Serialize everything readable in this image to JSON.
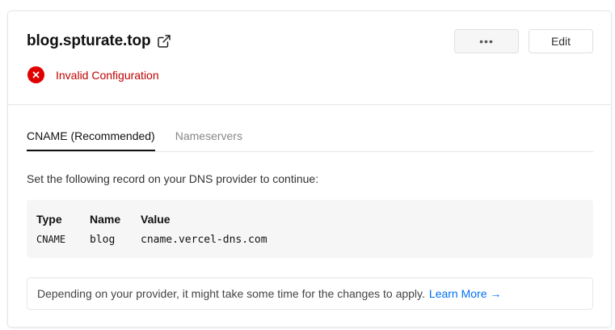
{
  "domain": {
    "name": "blog.spturate.top",
    "status": "Invalid Configuration"
  },
  "actions": {
    "more_label": "•••",
    "edit_label": "Edit"
  },
  "tabs": [
    {
      "label": "CNAME (Recommended)",
      "active": true
    },
    {
      "label": "Nameservers",
      "active": false
    }
  ],
  "instructions": "Set the following record on your DNS provider to continue:",
  "records": {
    "headers": [
      "Type",
      "Name",
      "Value"
    ],
    "rows": [
      {
        "type": "CNAME",
        "name": "blog",
        "value": "cname.vercel-dns.com"
      }
    ]
  },
  "note": {
    "text": "Depending on your provider, it might take some time for the changes to apply.",
    "link_label": "Learn More →"
  },
  "colors": {
    "error": "#e00000",
    "link": "#0070f3"
  }
}
